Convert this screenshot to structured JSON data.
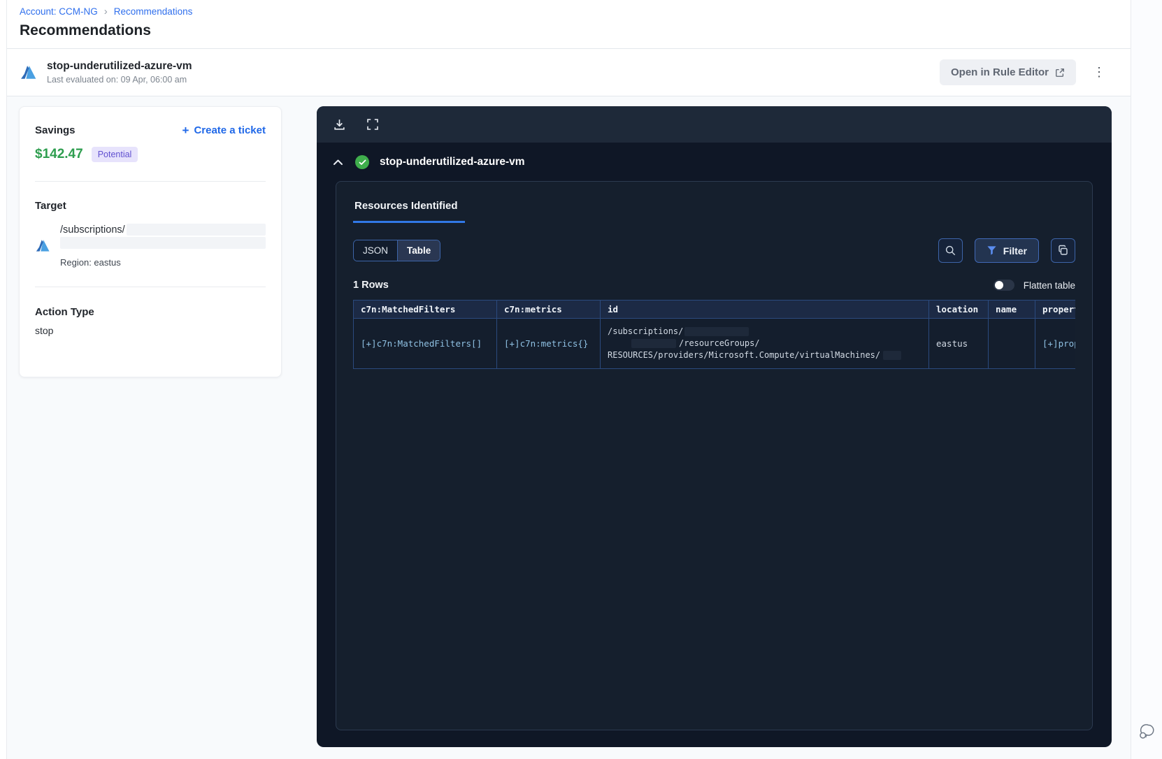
{
  "breadcrumb": {
    "account_link": "Account: CCM-NG",
    "separator": "›",
    "current": "Recommendations"
  },
  "page_title": "Recommendations",
  "header": {
    "name": "stop-underutilized-azure-vm",
    "last_evaluated": "Last evaluated on: 09 Apr, 06:00 am",
    "open_rule_editor_label": "Open in Rule Editor",
    "kebab_glyph": "⋮"
  },
  "savings_card": {
    "savings_label": "Savings",
    "amount": "$142.47",
    "badge": "Potential",
    "plus_glyph": "+",
    "create_ticket_label": "Create a ticket",
    "target_label": "Target",
    "target_path": "/subscriptions/",
    "region": "Region: eastus",
    "action_type_label": "Action Type",
    "action_type_value": "stop"
  },
  "viewer": {
    "rule_title": "stop-underutilized-azure-vm",
    "tab_label": "Resources Identified",
    "view_toggle": {
      "json": "JSON",
      "table": "Table"
    },
    "filter_label": "Filter",
    "rows_label": "1 Rows",
    "flatten_label": "Flatten table",
    "table": {
      "columns": [
        "c7n:MatchedFilters",
        "c7n:metrics",
        "id",
        "location",
        "name",
        "propert"
      ],
      "row": {
        "matched_filters": "[+]c7n:MatchedFilters[]",
        "metrics": "[+]c7n:metrics{}",
        "id_line1": "/subscriptions/",
        "id_line2": "/resourceGroups/",
        "id_line3": "RESOURCES/providers/Microsoft.Compute/virtualMachines/",
        "location": "eastus",
        "name": "",
        "properties": "[+]prop"
      }
    }
  },
  "colors": {
    "accent_blue": "#2f6fed",
    "tab_underline_blue": "#3178e6",
    "savings_green": "#2e9e4f",
    "badge_bg": "#e7e3fc",
    "badge_text": "#6050d0",
    "panel_bg": "#0f1726",
    "panel_header_bg": "#1e2939",
    "inner_box_bg": "#151f2d",
    "table_border": "#2b4a7e",
    "table_header_bg": "#1c2a45",
    "cell_text_blue": "#8fc1e3",
    "check_green": "#3fae4c"
  }
}
